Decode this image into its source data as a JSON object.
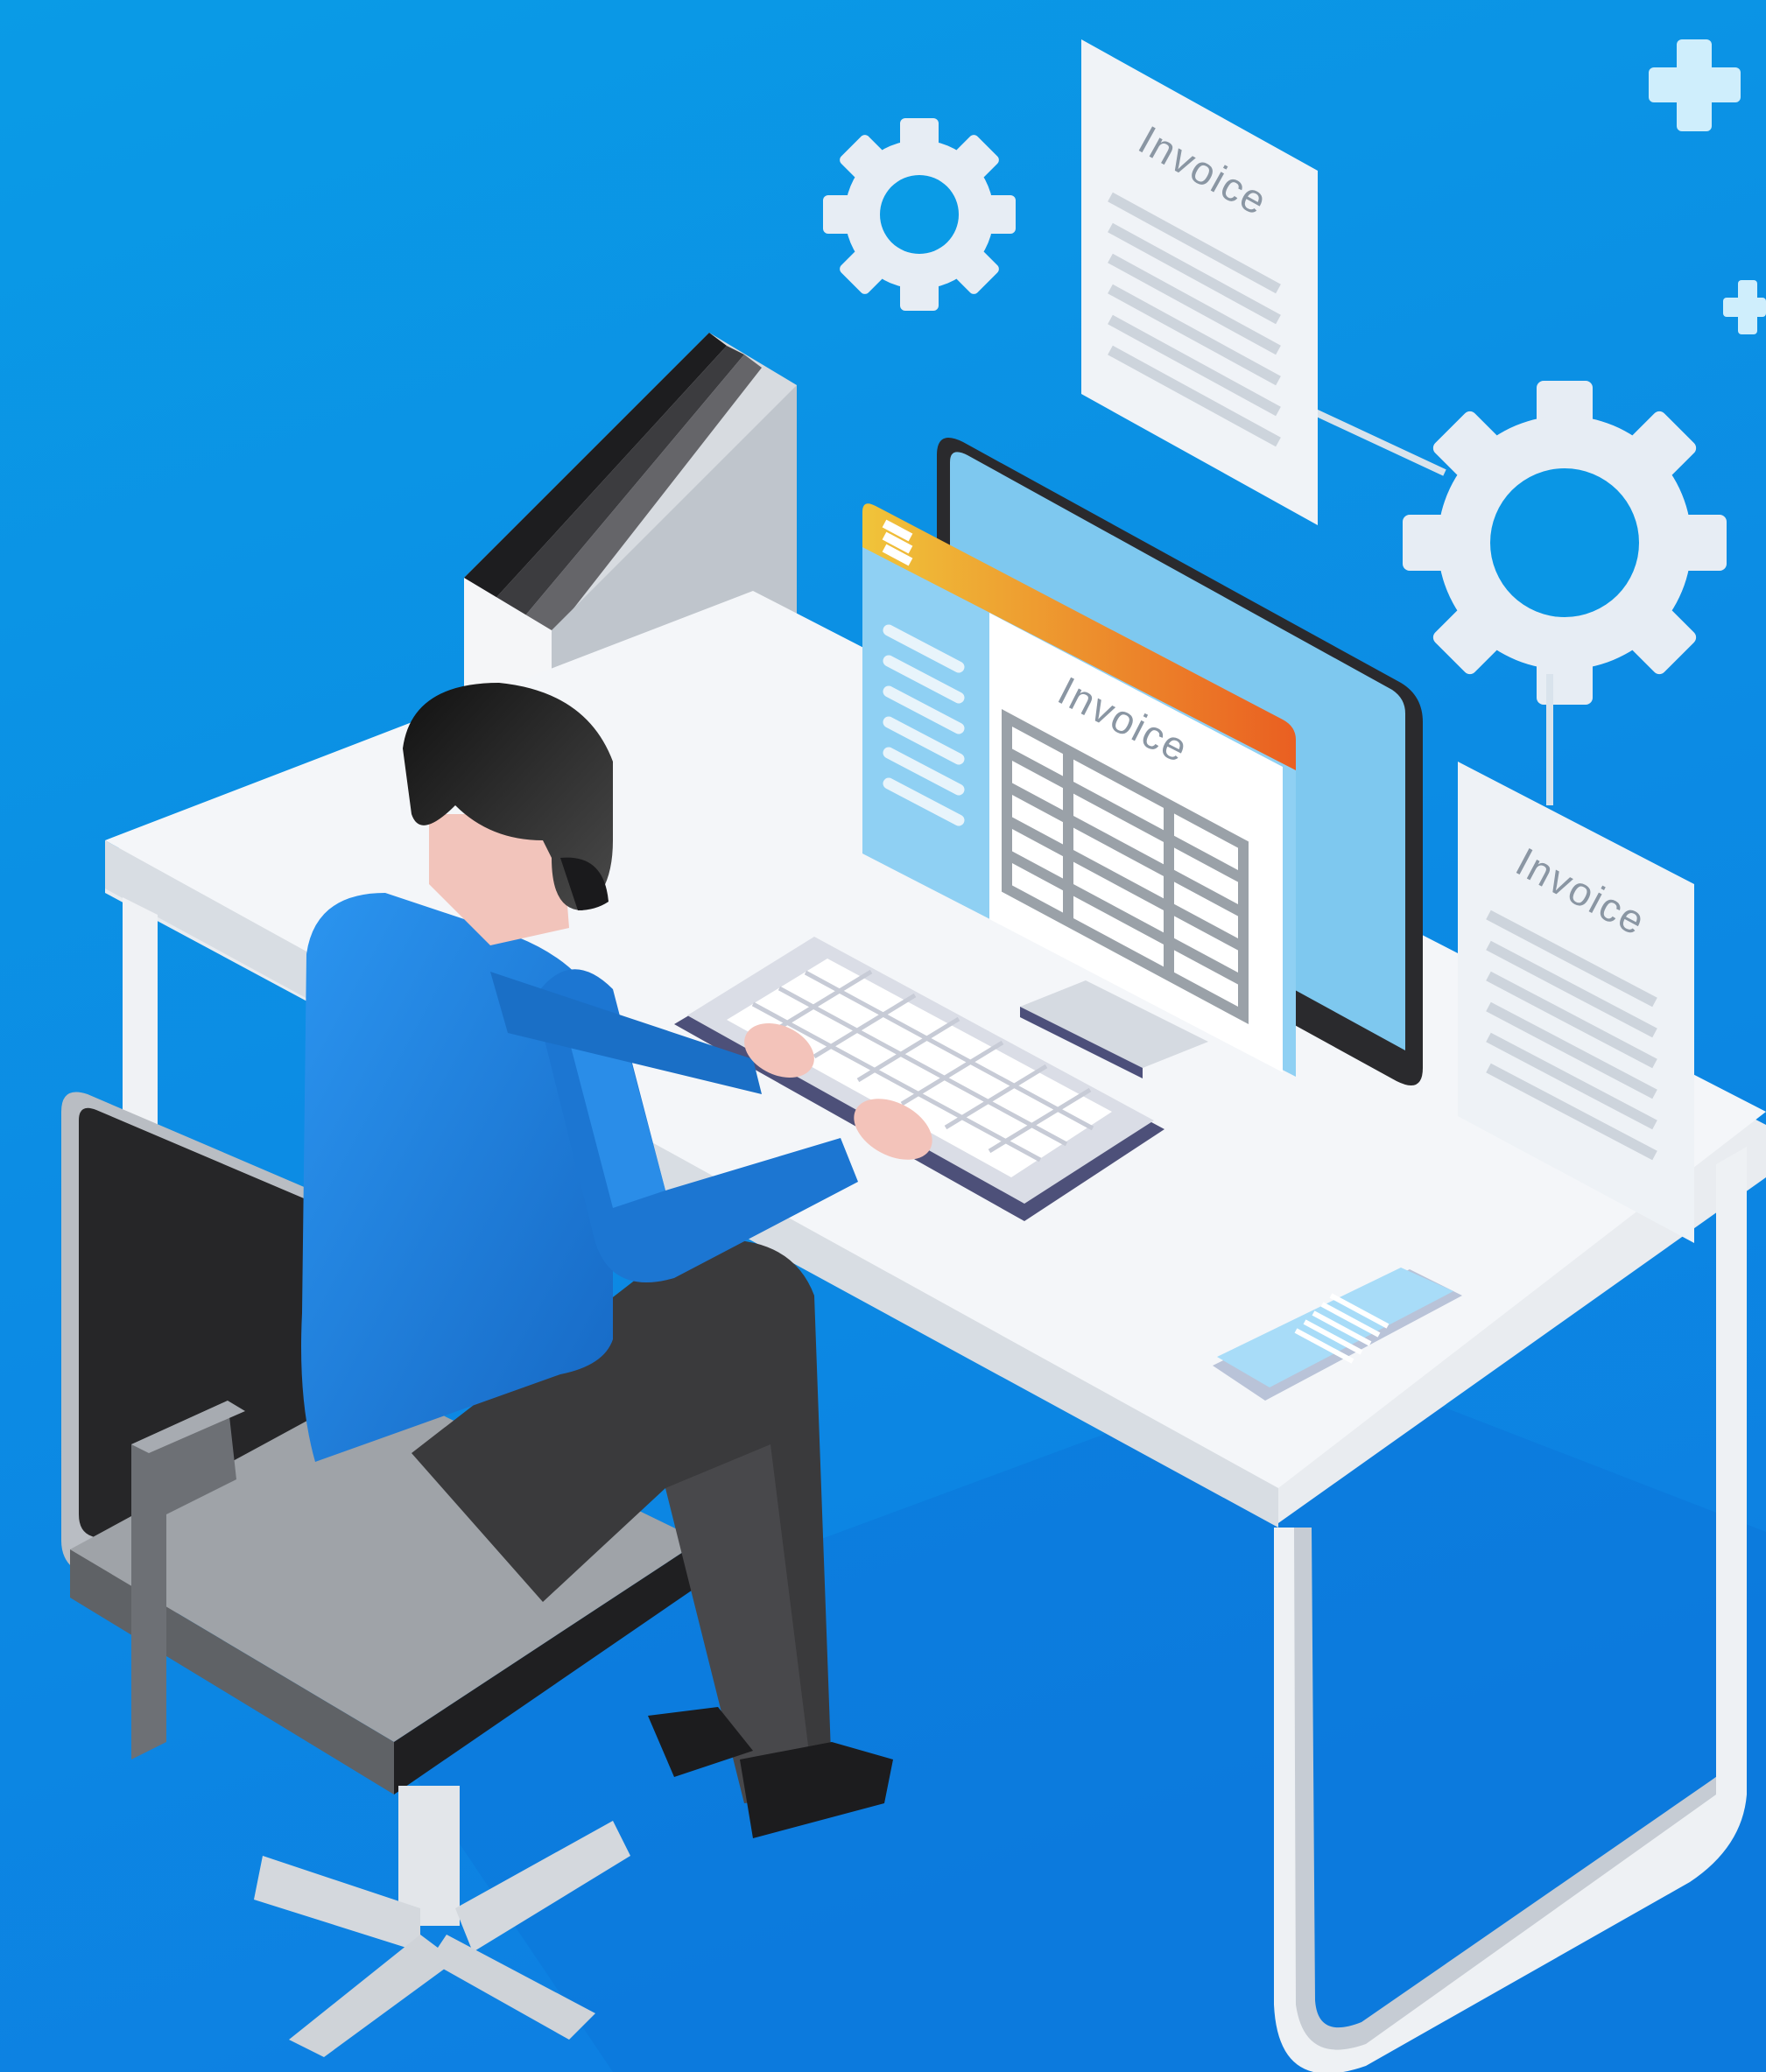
{
  "illustration": {
    "subject": "person-typing-at-desk",
    "labels": {
      "floating_invoice_top": "Invoice",
      "floating_invoice_right": "Invoice",
      "screen_invoice": "Invoice"
    },
    "icons": [
      "gear-icon",
      "plus-icon",
      "document-icon",
      "hamburger-menu-icon"
    ],
    "colors": {
      "background_top": "#0a9be6",
      "background_bottom": "#0d7ee0",
      "desk": "#f1f3f6",
      "shirt": "#1e88e5",
      "pants": "#3a3a3c",
      "hair": "#1f1f20",
      "skin": "#f4c9c0",
      "chair": "#2f2f31",
      "screen_accent": "#f58a1f",
      "screen_panel": "#8fd0f3"
    }
  }
}
